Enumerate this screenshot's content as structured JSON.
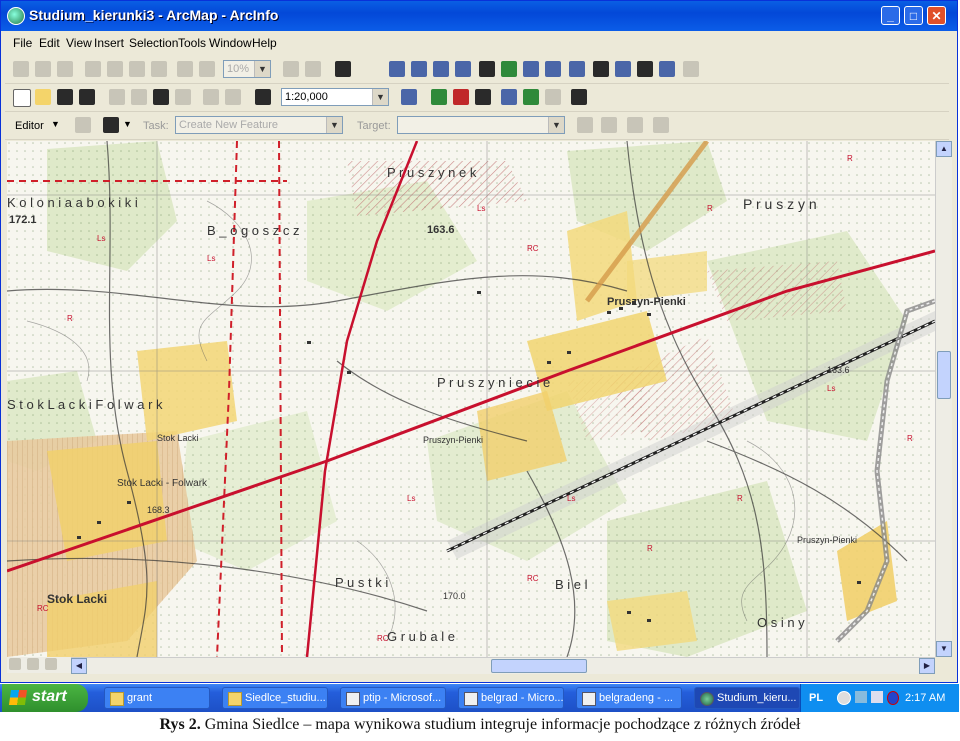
{
  "window": {
    "title": "Studium_kierunki3 - ArcMap - ArcInfo"
  },
  "menu": [
    "File",
    "Edit",
    "View",
    "Insert",
    "Selection",
    "Tools",
    "Window",
    "Help"
  ],
  "toolbar": {
    "zoom_percent": "10%",
    "scale": "1:20,000"
  },
  "editor": {
    "editor_label": "Editor",
    "task_label": "Task:",
    "task_value": "Create New Feature",
    "target_label": "Target:",
    "target_value": ""
  },
  "map": {
    "labels": {
      "prusyn_top": "P r u s z y n e k",
      "kolonia": "K o l o n i a     a b o k i k i",
      "pruszyn": "P r u s z y n",
      "blogoszcz": "B _ o g o s z c z",
      "pruszyn_pienki": "Pruszyn-Pienki",
      "pruszyn_pienki2": "Pruszyn-Pienki",
      "pruszyn_pienki3": "Pruszyn-Pienki",
      "pruszyniecie": "P r u s z y n i e c i e",
      "stok_lacki_folwark": "S t o k   L a c k i   F o l w a r k",
      "stok_lacki": "Stok Lacki",
      "stok_lacki2": "Stok Lacki",
      "stok_lacki_fm": "Stok Lacki - Folwark",
      "pustki": "P u s t k i",
      "grubale": "G r u b a l e",
      "biel": "B i e l",
      "osiny": "O s i n y",
      "h1": "172.1",
      "h2": "163.6",
      "h3": "168.3",
      "h4": "170.0",
      "h5": "163.6"
    }
  },
  "taskbar": {
    "start": "start",
    "tasks": [
      "grant",
      "Siedlce_studiu...",
      "ptip - Microsof...",
      "belgrad - Micro...",
      "belgradeng - ...",
      "Studium_kieru..."
    ],
    "lang": "PL",
    "time": "2:17 AM"
  },
  "caption": {
    "label": "Rys 2.",
    "text": "Gmina Siedlce – mapa wynikowa studium integruje informacje pochodzące z różnych źródeł"
  }
}
